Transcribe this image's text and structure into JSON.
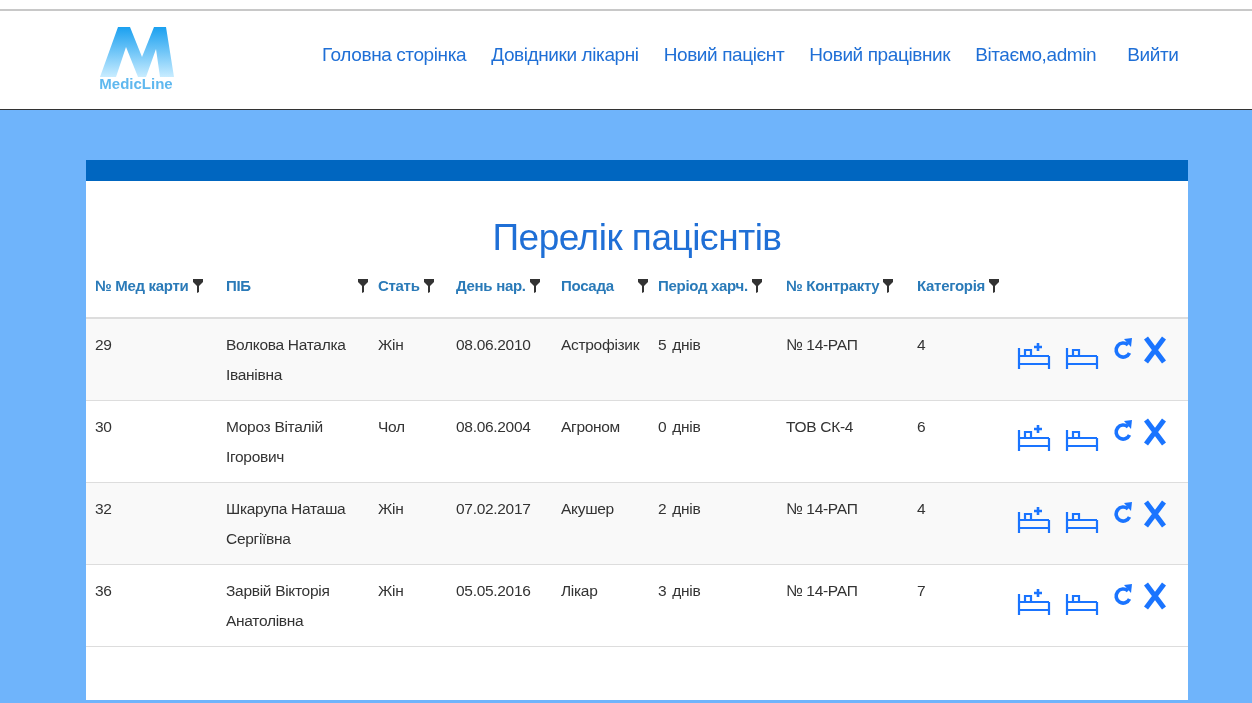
{
  "logo": {
    "text": "MedicLine"
  },
  "nav": [
    "Головна сторінка",
    "Довідники лікарні",
    "Новий пацієнт",
    "Новий працівник",
    "Вітаємо,admin",
    "Вийти"
  ],
  "title": "Перелік пацієнтів",
  "table": {
    "columns": [
      "№ Мед карти",
      "ПІБ",
      "Стать",
      "День нар.",
      "Посада",
      "Період харч.",
      "№ Контракту",
      "Категорія"
    ],
    "rows": [
      {
        "card": "29",
        "name": "Волкова Наталка Іванівна",
        "sex": "Жін",
        "birth": "08.06.2010",
        "position": "Астрофізик",
        "period": {
          "number": "5",
          "unit": "днів"
        },
        "contract": "№ 14-РАП",
        "category": "4"
      },
      {
        "card": "30",
        "name": "Мороз Віталій Ігорович",
        "sex": "Чол",
        "birth": "08.06.2004",
        "position": "Агроном",
        "period": {
          "number": "0",
          "unit": "днів"
        },
        "contract": "ТОВ СК-4",
        "category": "6"
      },
      {
        "card": "32",
        "name": "Шкарупа Наташа Сергіївна",
        "sex": "Жін",
        "birth": "07.02.2017",
        "position": "Акушер",
        "period": {
          "number": "2",
          "unit": "днів"
        },
        "contract": "№ 14-РАП",
        "category": "4"
      },
      {
        "card": "36",
        "name": "Зарвій Вікторія Анатолівна",
        "sex": "Жін",
        "birth": "05.05.2016",
        "position": "Лікар",
        "period": {
          "number": "3",
          "unit": "днів"
        },
        "contract": "№ 14-РАП",
        "category": "7"
      }
    ]
  }
}
